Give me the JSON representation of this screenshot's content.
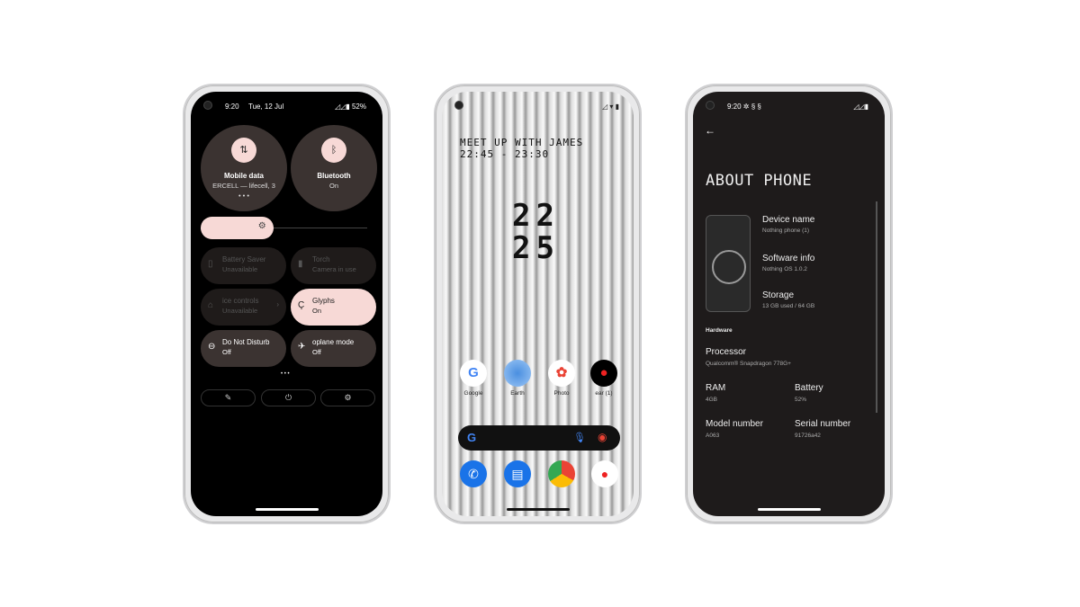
{
  "quick_settings": {
    "time": "9:20",
    "date": "Tue, 12 Jul",
    "battery": "52%",
    "big_tiles": [
      {
        "title": "Mobile data",
        "sub": "ERCELL — lifecell, 3",
        "icon": "arrows-updown-icon"
      },
      {
        "title": "Bluetooth",
        "sub": "On",
        "icon": "bluetooth-icon"
      }
    ],
    "brightness": 0.42,
    "tiles": [
      {
        "title": "Battery Saver",
        "sub": "Unavailable",
        "state": "disabled"
      },
      {
        "title": "Torch",
        "sub": "Camera in use",
        "state": "disabled"
      },
      {
        "title": "ice controls",
        "sub": "Unavailable",
        "state": "disabled"
      },
      {
        "title": "Glyphs",
        "sub": "On",
        "state": "active"
      },
      {
        "title": "Do Not Disturb",
        "sub": "Off",
        "state": "off"
      },
      {
        "title": "oplane mode",
        "sub": "Off",
        "state": "off"
      }
    ],
    "accent": "#f7d9d6"
  },
  "home": {
    "event_title": "MEET UP WITH JAMES",
    "event_time": "22:45 - 23:30",
    "clock_h": "22",
    "clock_m": "25",
    "apps": [
      {
        "label": "Google"
      },
      {
        "label": "Earth"
      },
      {
        "label": "Photo"
      },
      {
        "label": "ear (1)"
      }
    ]
  },
  "about": {
    "time": "9:20",
    "title": "ABOUT PHONE",
    "items": [
      {
        "label": "Device name",
        "value": "Nothing phone (1)"
      },
      {
        "label": "Software info",
        "value": "Nothing OS 1.0.2"
      },
      {
        "label": "Storage",
        "value": "13 GB used / 64 GB"
      }
    ],
    "section": "Hardware",
    "processor": {
      "label": "Processor",
      "value": "Qualcomm® Snapdragon 778G+"
    },
    "ram": {
      "label": "RAM",
      "value": "4GB"
    },
    "battery": {
      "label": "Battery",
      "value": "52%"
    },
    "model": {
      "label": "Model number",
      "value": "A063"
    },
    "serial": {
      "label": "Serial number",
      "value": "91726a42"
    }
  }
}
